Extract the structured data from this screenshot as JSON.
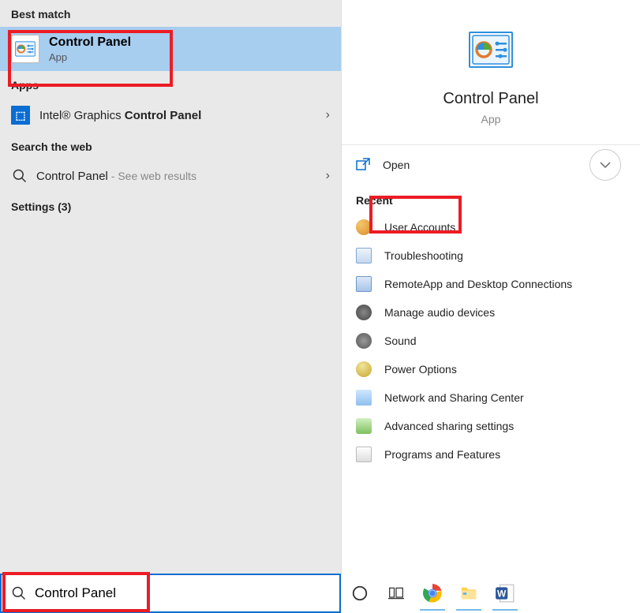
{
  "left": {
    "best_match_header": "Best match",
    "best_match": {
      "title": "Control Panel",
      "subtitle": "App"
    },
    "apps_header": "Apps",
    "apps_item": {
      "prefix": "Intel® Graphics ",
      "bold": "Control Panel"
    },
    "web_header": "Search the web",
    "web_item": {
      "title": "Control Panel",
      "suffix": " - See web results"
    },
    "settings_header": "Settings (3)"
  },
  "right": {
    "title": "Control Panel",
    "subtitle": "App",
    "open_label": "Open",
    "recent_header": "Recent",
    "recent": [
      "User Accounts",
      "Troubleshooting",
      "RemoteApp and Desktop Connections",
      "Manage audio devices",
      "Sound",
      "Power Options",
      "Network and Sharing Center",
      "Advanced sharing settings",
      "Programs and Features"
    ]
  },
  "search": {
    "value": "Control Panel"
  }
}
